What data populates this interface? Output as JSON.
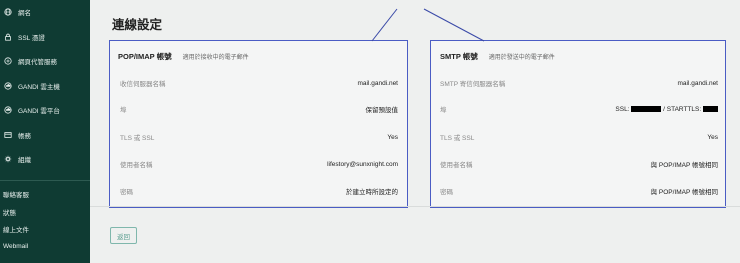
{
  "sidebar": {
    "items": [
      {
        "label": "網名",
        "icon": "globe-icon"
      },
      {
        "label": "SSL 憑證",
        "icon": "lock-icon"
      },
      {
        "label": "網頁代管服務",
        "icon": "hosting-icon"
      },
      {
        "label": "GANDI 雲主機",
        "icon": "cloud-icon"
      },
      {
        "label": "GANDI 雲平台",
        "icon": "cloud-icon"
      },
      {
        "label": "帳務",
        "icon": "billing-icon"
      },
      {
        "label": "組織",
        "icon": "organization-icon"
      }
    ],
    "footer": [
      "聯絡客服",
      "狀態",
      "線上文件",
      "Webmail"
    ]
  },
  "page": {
    "title": "連線設定"
  },
  "pop_card": {
    "title": "POP/IMAP 帳號",
    "subtitle": "適用於接收中的電子郵件",
    "rows": [
      {
        "label": "收信伺服器名稱",
        "value": "mail.gandi.net"
      },
      {
        "label": "埠",
        "value": "保留預設值"
      },
      {
        "label": "TLS 或 SSL",
        "value": "Yes"
      },
      {
        "label": "使用者名稱",
        "value": "lifestory@sunxnight.com"
      },
      {
        "label": "密碼",
        "value": "於建立時所設定的"
      }
    ]
  },
  "smtp_card": {
    "title": "SMTP 帳號",
    "subtitle": "適用於發送中的電子郵件",
    "rows": [
      {
        "label": "SMTP 寄信伺服器名稱",
        "value": "mail.gandi.net"
      },
      {
        "label": "埠",
        "value_prefix": "SSL:",
        "value_middle": "/ STARTTLS:"
      },
      {
        "label": "TLS 或 SSL",
        "value": "Yes"
      },
      {
        "label": "使用者名稱",
        "value": "與 POP/IMAP 帳號相同"
      },
      {
        "label": "密碼",
        "value": "與 POP/IMAP 帳號相同"
      }
    ]
  },
  "back_button": "返回",
  "colors": {
    "sidebar": "#0f3b33",
    "highlight": "#4a5cc4",
    "accent": "#5c9f91"
  }
}
